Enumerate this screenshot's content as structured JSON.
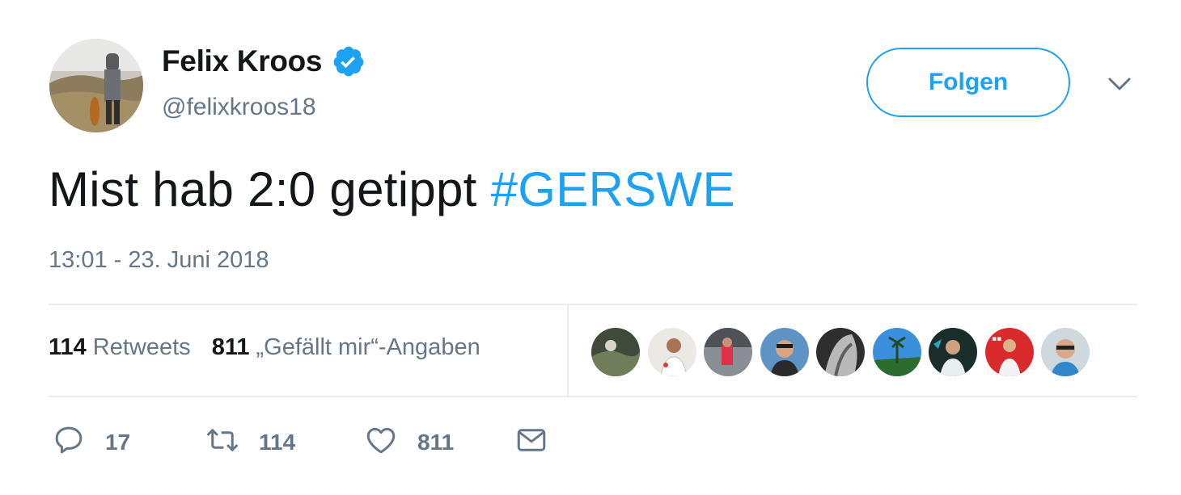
{
  "tweet": {
    "author_name": "Felix Kroos",
    "author_handle": "@felixkroos18",
    "follow_label": "Folgen",
    "text_main": "Mist hab 2:0 getippt ",
    "text_hashtag": "#GERSWE",
    "timestamp": "13:01 - 23. Juni 2018"
  },
  "stats": {
    "retweets_count": "114",
    "retweets_label": "Retweets",
    "likes_count": "811",
    "likes_label": "„Gefällt mir“-Angaben"
  },
  "actions": {
    "reply_count": "17",
    "retweet_count": "114",
    "like_count": "811"
  },
  "colors": {
    "accent": "#1da1f2",
    "muted": "#657786",
    "text": "#14171a",
    "divider": "#e6ecf0"
  },
  "icons": [
    "verified-badge-icon",
    "chevron-down-icon",
    "reply-icon",
    "retweet-icon",
    "heart-icon",
    "envelope-icon"
  ]
}
